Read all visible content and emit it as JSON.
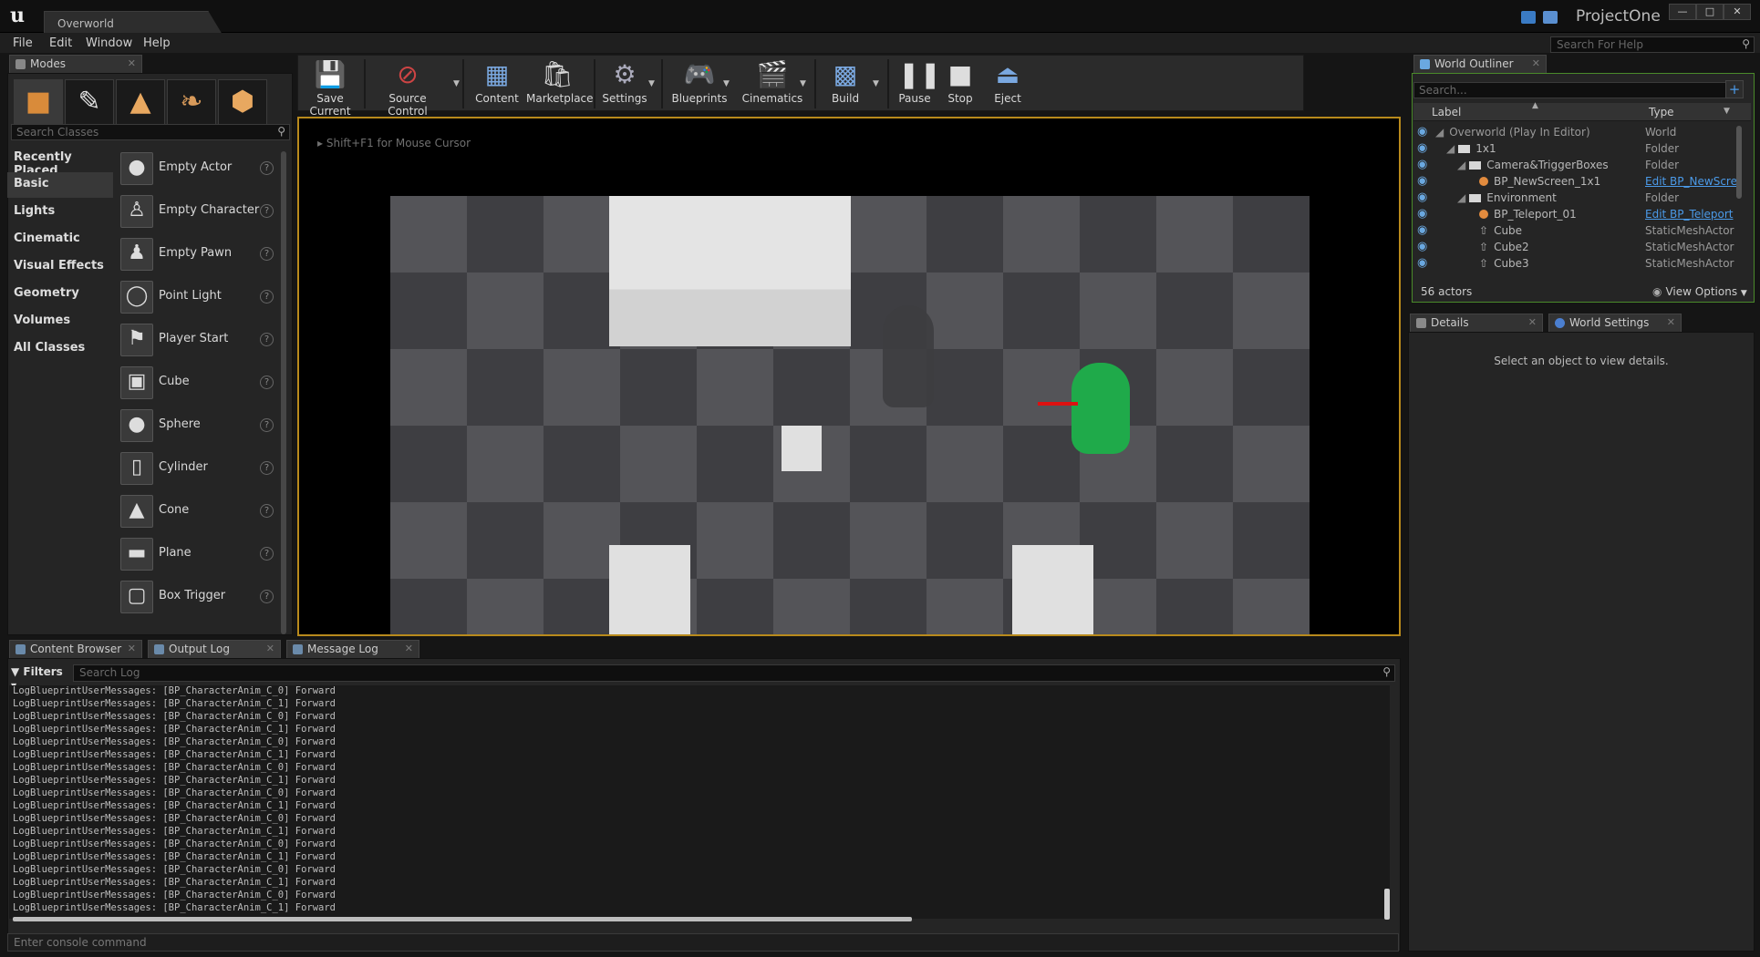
{
  "window": {
    "doc_tab": "Overworld",
    "project_name": "ProjectOne"
  },
  "menu": [
    "File",
    "Edit",
    "Window",
    "Help"
  ],
  "help_search_placeholder": "Search For Help",
  "modes": {
    "tab_label": "Modes",
    "search_placeholder": "Search Classes",
    "categories": [
      "Recently Placed",
      "Basic",
      "Lights",
      "Cinematic",
      "Visual Effects",
      "Geometry",
      "Volumes",
      "All Classes"
    ],
    "active_category": "Basic",
    "items": [
      "Empty Actor",
      "Empty Character",
      "Empty Pawn",
      "Point Light",
      "Player Start",
      "Cube",
      "Sphere",
      "Cylinder",
      "Cone",
      "Plane",
      "Box Trigger"
    ]
  },
  "toolbar": {
    "save": "Save Current",
    "source_control": "Source Control",
    "content": "Content",
    "marketplace": "Marketplace",
    "settings": "Settings",
    "blueprints": "Blueprints",
    "cinematics": "Cinematics",
    "build": "Build",
    "pause": "Pause",
    "stop": "Stop",
    "eject": "Eject"
  },
  "viewport": {
    "hint": "Shift+F1 for Mouse Cursor"
  },
  "outliner": {
    "tab_label": "World Outliner",
    "search_placeholder": "Search...",
    "col_label": "Label",
    "col_type": "Type",
    "rows": [
      {
        "label": "Overworld (Play In Editor)",
        "type": "World"
      },
      {
        "label": "1x1",
        "type": "Folder"
      },
      {
        "label": "Camera&TriggerBoxes",
        "type": "Folder"
      },
      {
        "label": "BP_NewScreen_1x1",
        "type": "Edit BP_NewScre"
      },
      {
        "label": "Environment",
        "type": "Folder"
      },
      {
        "label": "BP_Teleport_01",
        "type": "Edit BP_Teleport"
      },
      {
        "label": "Cube",
        "type": "StaticMeshActor"
      },
      {
        "label": "Cube2",
        "type": "StaticMeshActor"
      },
      {
        "label": "Cube3",
        "type": "StaticMeshActor"
      }
    ],
    "actor_count": "56 actors",
    "view_options": "View Options"
  },
  "details": {
    "tab_label": "Details",
    "world_settings_tab": "World Settings",
    "empty_text": "Select an object to view details."
  },
  "bottom_tabs": [
    "Content Browser",
    "Output Log",
    "Message Log"
  ],
  "log": {
    "filters": "Filters",
    "search_placeholder": "Search Log",
    "lines": [
      "LogBlueprintUserMessages: [BP_CharacterAnim_C_0] Forward",
      "LogBlueprintUserMessages: [BP_CharacterAnim_C_1] Forward",
      "LogBlueprintUserMessages: [BP_CharacterAnim_C_0] Forward",
      "LogBlueprintUserMessages: [BP_CharacterAnim_C_1] Forward",
      "LogBlueprintUserMessages: [BP_CharacterAnim_C_0] Forward",
      "LogBlueprintUserMessages: [BP_CharacterAnim_C_1] Forward",
      "LogBlueprintUserMessages: [BP_CharacterAnim_C_0] Forward",
      "LogBlueprintUserMessages: [BP_CharacterAnim_C_1] Forward",
      "LogBlueprintUserMessages: [BP_CharacterAnim_C_0] Forward",
      "LogBlueprintUserMessages: [BP_CharacterAnim_C_1] Forward",
      "LogBlueprintUserMessages: [BP_CharacterAnim_C_0] Forward",
      "LogBlueprintUserMessages: [BP_CharacterAnim_C_1] Forward",
      "LogBlueprintUserMessages: [BP_CharacterAnim_C_0] Forward",
      "LogBlueprintUserMessages: [BP_CharacterAnim_C_1] Forward",
      "LogBlueprintUserMessages: [BP_CharacterAnim_C_0] Forward",
      "LogBlueprintUserMessages: [BP_CharacterAnim_C_1] Forward",
      "LogBlueprintUserMessages: [BP_CharacterAnim_C_0] Forward",
      "LogBlueprintUserMessages: [BP_CharacterAnim_C_1] Forward"
    ]
  },
  "console_placeholder": "Enter console command",
  "colors": {
    "accent_blue": "#3a7bc4",
    "link_blue": "#4b9ae8",
    "viewport_border": "#b88a1c",
    "character_green": "#1faa4a"
  }
}
